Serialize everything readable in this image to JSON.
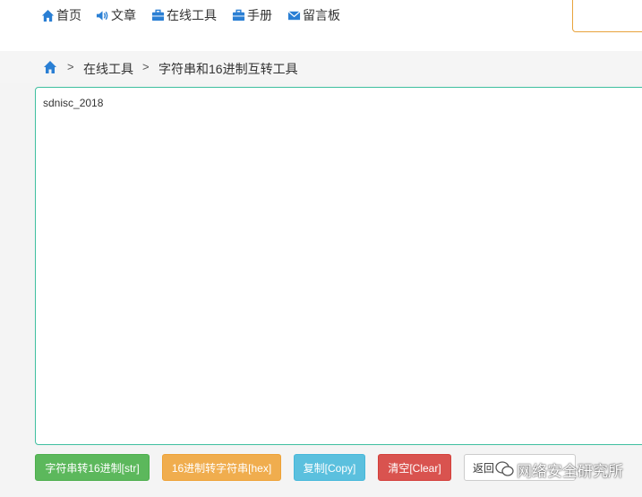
{
  "nav": {
    "items": [
      {
        "label": "首页",
        "icon": "home-icon"
      },
      {
        "label": "文章",
        "icon": "volume-icon"
      },
      {
        "label": "在线工具",
        "icon": "briefcase-icon"
      },
      {
        "label": "手册",
        "icon": "briefcase-icon"
      },
      {
        "label": "留言板",
        "icon": "envelope-icon"
      }
    ],
    "accent_color": "#2a7fd4"
  },
  "breadcrumb": {
    "items": [
      "在线工具",
      "字符串和16进制互转工具"
    ],
    "separator": ">"
  },
  "editor": {
    "value": "sdnisc_2018"
  },
  "buttons": {
    "str_to_hex": "字符串转16进制[str]",
    "hex_to_str": "16进制转字符串[hex]",
    "copy": "复制[Copy]",
    "clear": "清空[Clear]",
    "back": "返回"
  },
  "watermark": {
    "text": "网络安全研究所"
  },
  "colors": {
    "green": "#5cb85c",
    "orange": "#f0ad4e",
    "blue": "#5bc0de",
    "red": "#d9534f",
    "editor_border": "#3fbf9f"
  }
}
